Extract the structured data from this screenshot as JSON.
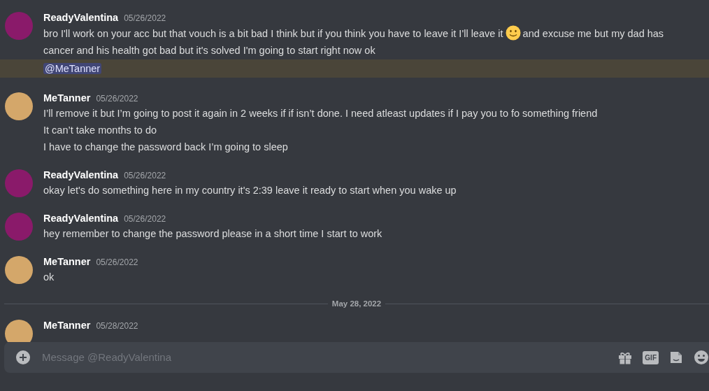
{
  "feed": [
    {
      "kind": "message",
      "author": "ReadyValentina",
      "color": "#8a1a6a",
      "date": "05/26/2022",
      "lines": [
        {
          "kind": "text",
          "segments": [
            {
              "kind": "text",
              "text": "bro I'll work on your acc but that vouch is a bit bad I think but if you think you have to leave it I'll leave it"
            },
            {
              "kind": "emoji"
            },
            {
              "kind": "text",
              "text": "and excuse me but my dad has"
            }
          ]
        },
        {
          "kind": "text",
          "segments": [
            {
              "kind": "text",
              "text": "cancer and his health got bad but it's solved I'm going to start right now ok"
            }
          ]
        },
        {
          "kind": "mention",
          "highlighted": true,
          "text": "@MeTanner"
        }
      ]
    },
    {
      "kind": "message",
      "author": "MeTanner",
      "color": "#d4a76a",
      "date": "05/26/2022",
      "lines": [
        {
          "kind": "text",
          "segments": [
            {
              "kind": "text",
              "text": "I’ll remove it but I’m going to post it again in 2 weeks if if isn’t done. I need atleast updates if I pay you to fo something friend"
            }
          ]
        },
        {
          "kind": "text",
          "segments": [
            {
              "kind": "text",
              "text": "It can’t take months to do"
            }
          ]
        },
        {
          "kind": "text",
          "segments": [
            {
              "kind": "text",
              "text": "I have to change the password back I’m going to sleep"
            }
          ]
        }
      ]
    },
    {
      "kind": "message",
      "author": "ReadyValentina",
      "color": "#8a1a6a",
      "date": "05/26/2022",
      "lines": [
        {
          "kind": "text",
          "segments": [
            {
              "kind": "text",
              "text": "okay let's do something here in my country it's 2:39 leave it ready to start when you wake up"
            }
          ]
        }
      ]
    },
    {
      "kind": "message",
      "author": "ReadyValentina",
      "color": "#8a1a6a",
      "date": "05/26/2022",
      "lines": [
        {
          "kind": "text",
          "segments": [
            {
              "kind": "text",
              "text": "hey remember to change the password please in a short time I start to work"
            }
          ]
        }
      ]
    },
    {
      "kind": "message",
      "author": "MeTanner",
      "color": "#d4a76a",
      "date": "05/26/2022",
      "lines": [
        {
          "kind": "text",
          "segments": [
            {
              "kind": "text",
              "text": "ok"
            }
          ]
        }
      ]
    },
    {
      "kind": "divider",
      "label": "May 28, 2022"
    },
    {
      "kind": "message",
      "author": "MeTanner",
      "color": "#d4a76a",
      "date": "05/28/2022"
    }
  ],
  "composer": {
    "placeholder": "Message @ReadyValentina",
    "gif_label": "GIF"
  }
}
